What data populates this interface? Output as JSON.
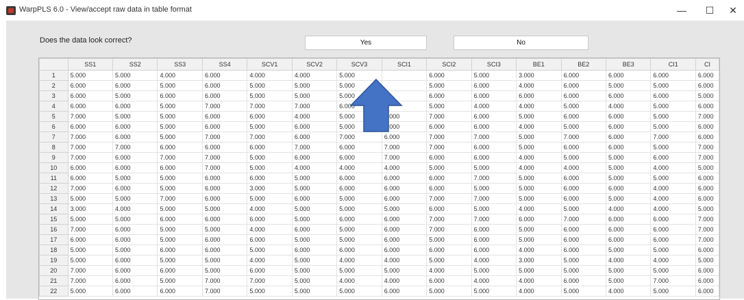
{
  "window": {
    "title": "WarpPLS 6.0 - View/accept raw data in table format"
  },
  "window_controls": {
    "minimize": "—",
    "maximize": "☐",
    "close": "✕"
  },
  "prompt": {
    "question": "Does the data look correct?"
  },
  "buttons": {
    "yes": "Yes",
    "no": "No"
  },
  "table": {
    "columns": [
      "",
      "SS1",
      "SS2",
      "SS3",
      "SS4",
      "SCV1",
      "SCV2",
      "SCV3",
      "SCI1",
      "SCI2",
      "SCI3",
      "BE1",
      "BE2",
      "BE3",
      "CI1",
      "CI"
    ],
    "rows": [
      [
        "1",
        "5.000",
        "5.000",
        "4.000",
        "6.000",
        "4.000",
        "4.000",
        "5.000",
        "",
        "6.000",
        "5.000",
        "3.000",
        "6.000",
        "6.000",
        "6.000",
        "6.000"
      ],
      [
        "2",
        "6.000",
        "6.000",
        "5.000",
        "6.000",
        "5.000",
        "5.000",
        "5.000",
        "",
        "5.000",
        "6.000",
        "4.000",
        "6.000",
        "5.000",
        "5.000",
        "6.000"
      ],
      [
        "3",
        "6.000",
        "5.000",
        "6.000",
        "6.000",
        "5.000",
        "5.000",
        "5.000",
        "",
        "6.000",
        "6.000",
        "6.000",
        "6.000",
        "6.000",
        "6.000",
        "5.000"
      ],
      [
        "4",
        "6.000",
        "6.000",
        "5.000",
        "7.000",
        "7.000",
        "7.000",
        "6.000",
        "",
        "5.000",
        "4.000",
        "4.000",
        "5.000",
        "4.000",
        "5.000",
        "6.000"
      ],
      [
        "5",
        "7.000",
        "5.000",
        "5.000",
        "6.000",
        "6.000",
        "4.000",
        "5.000",
        "6.000",
        "7.000",
        "6.000",
        "5.000",
        "6.000",
        "6.000",
        "5.000",
        "7.000"
      ],
      [
        "6",
        "6.000",
        "6.000",
        "5.000",
        "6.000",
        "5.000",
        "6.000",
        "5.000",
        "6.000",
        "6.000",
        "6.000",
        "4.000",
        "5.000",
        "6.000",
        "5.000",
        "6.000"
      ],
      [
        "7",
        "7.000",
        "6.000",
        "5.000",
        "7.000",
        "7.000",
        "6.000",
        "7.000",
        "6.000",
        "7.000",
        "7.000",
        "5.000",
        "7.000",
        "6.000",
        "7.000",
        "6.000"
      ],
      [
        "8",
        "7.000",
        "7.000",
        "6.000",
        "6.000",
        "6.000",
        "7.000",
        "6.000",
        "7.000",
        "7.000",
        "6.000",
        "5.000",
        "6.000",
        "6.000",
        "5.000",
        "7.000"
      ],
      [
        "9",
        "7.000",
        "6.000",
        "7.000",
        "7.000",
        "5.000",
        "6.000",
        "6.000",
        "7.000",
        "6.000",
        "6.000",
        "4.000",
        "5.000",
        "5.000",
        "6.000",
        "7.000"
      ],
      [
        "10",
        "6.000",
        "6.000",
        "6.000",
        "7.000",
        "5.000",
        "4.000",
        "4.000",
        "4.000",
        "5.000",
        "5.000",
        "4.000",
        "4.000",
        "5.000",
        "4.000",
        "5.000"
      ],
      [
        "11",
        "6.000",
        "5.000",
        "5.000",
        "6.000",
        "6.000",
        "5.000",
        "6.000",
        "6.000",
        "6.000",
        "7.000",
        "5.000",
        "6.000",
        "5.000",
        "5.000",
        "6.000"
      ],
      [
        "12",
        "7.000",
        "6.000",
        "5.000",
        "6.000",
        "3.000",
        "5.000",
        "6.000",
        "6.000",
        "6.000",
        "5.000",
        "5.000",
        "6.000",
        "6.000",
        "4.000",
        "6.000"
      ],
      [
        "13",
        "5.000",
        "5.000",
        "7.000",
        "6.000",
        "5.000",
        "6.000",
        "5.000",
        "6.000",
        "7.000",
        "7.000",
        "5.000",
        "6.000",
        "5.000",
        "4.000",
        "6.000"
      ],
      [
        "14",
        "3.000",
        "4.000",
        "5.000",
        "5.000",
        "4.000",
        "5.000",
        "5.000",
        "5.000",
        "6.000",
        "5.000",
        "4.000",
        "5.000",
        "4.000",
        "4.000",
        "5.000"
      ],
      [
        "15",
        "5.000",
        "5.000",
        "6.000",
        "6.000",
        "6.000",
        "5.000",
        "6.000",
        "6.000",
        "7.000",
        "7.000",
        "6.000",
        "7.000",
        "6.000",
        "6.000",
        "7.000"
      ],
      [
        "16",
        "7.000",
        "6.000",
        "5.000",
        "5.000",
        "4.000",
        "6.000",
        "5.000",
        "6.000",
        "7.000",
        "6.000",
        "5.000",
        "6.000",
        "6.000",
        "6.000",
        "7.000"
      ],
      [
        "17",
        "6.000",
        "6.000",
        "5.000",
        "6.000",
        "6.000",
        "5.000",
        "5.000",
        "6.000",
        "5.000",
        "6.000",
        "5.000",
        "6.000",
        "6.000",
        "6.000",
        "7.000"
      ],
      [
        "18",
        "5.000",
        "5.000",
        "6.000",
        "6.000",
        "5.000",
        "6.000",
        "6.000",
        "6.000",
        "6.000",
        "6.000",
        "4.000",
        "6.000",
        "5.000",
        "5.000",
        "6.000"
      ],
      [
        "19",
        "5.000",
        "6.000",
        "5.000",
        "5.000",
        "4.000",
        "5.000",
        "4.000",
        "4.000",
        "5.000",
        "4.000",
        "3.000",
        "5.000",
        "4.000",
        "4.000",
        "5.000"
      ],
      [
        "20",
        "7.000",
        "6.000",
        "6.000",
        "5.000",
        "6.000",
        "5.000",
        "5.000",
        "5.000",
        "4.000",
        "5.000",
        "5.000",
        "5.000",
        "5.000",
        "5.000",
        "6.000"
      ],
      [
        "21",
        "7.000",
        "6.000",
        "5.000",
        "7.000",
        "7.000",
        "5.000",
        "4.000",
        "4.000",
        "6.000",
        "4.000",
        "4.000",
        "6.000",
        "5.000",
        "7.000",
        "6.000"
      ],
      [
        "22",
        "5.000",
        "6.000",
        "6.000",
        "7.000",
        "5.000",
        "5.000",
        "5.000",
        "6.000",
        "5.000",
        "5.000",
        "4.000",
        "5.000",
        "4.000",
        "5.000",
        "6.000"
      ]
    ]
  },
  "annotation": {
    "arrow_icon": "up-arrow-icon",
    "arrow_color": "#4472c4"
  }
}
